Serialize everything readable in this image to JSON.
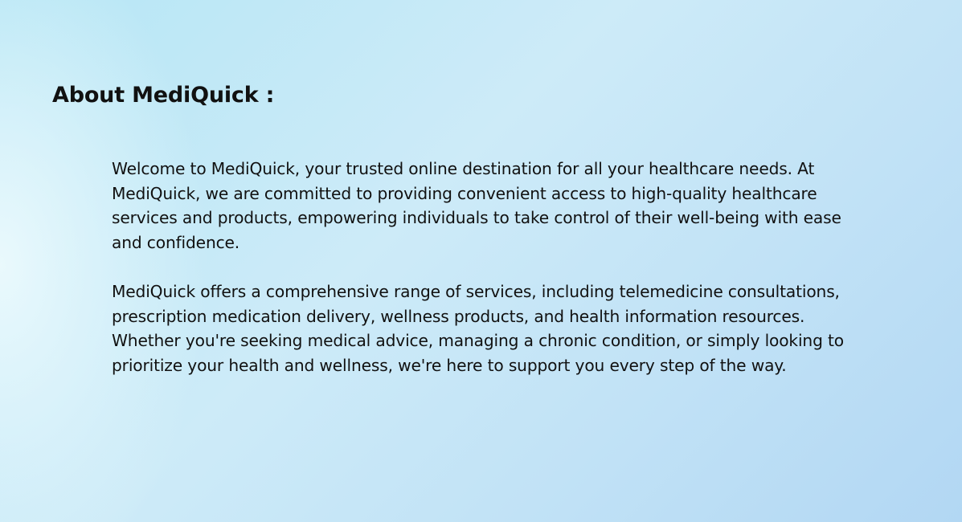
{
  "about": {
    "title": "About MediQuick :",
    "paragraphs": [
      "Welcome to MediQuick, your trusted online destination for all your healthcare needs. At MediQuick, we are committed to providing convenient access to high-quality healthcare services and products, empowering individuals to take control of their well-being with ease and confidence.",
      "MediQuick offers a comprehensive range of services, including telemedicine consultations, prescription medication delivery, wellness products, and health information resources. Whether you're seeking medical advice, managing a chronic condition, or simply looking to prioritize your health and wellness, we're here to support you every step of the way."
    ]
  },
  "colors": {
    "background_start": "#b6e6f5",
    "background_end": "#b2d7f3",
    "text": "#111111"
  }
}
